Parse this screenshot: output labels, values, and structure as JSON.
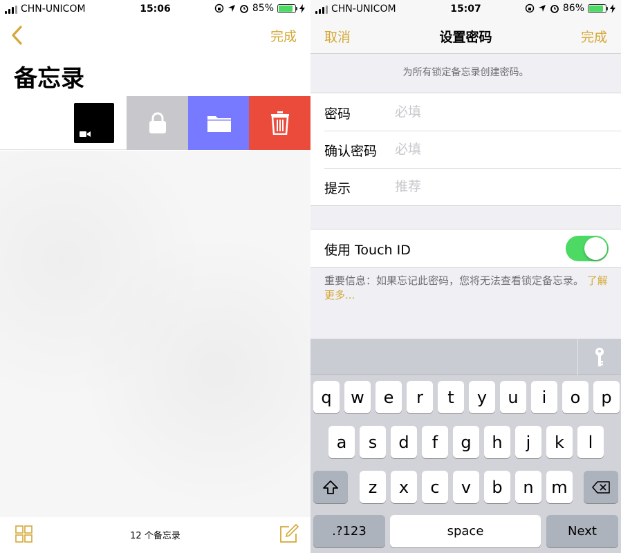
{
  "left": {
    "status": {
      "carrier": "CHN-UNICOM",
      "time": "15:06",
      "battery": "85%",
      "battery_level": 0.85
    },
    "nav": {
      "done": "完成"
    },
    "title": "备忘录",
    "bottom": {
      "count": "12 个备忘录"
    }
  },
  "right": {
    "status": {
      "carrier": "CHN-UNICOM",
      "time": "15:07",
      "battery": "86%",
      "battery_level": 0.86
    },
    "nav": {
      "cancel": "取消",
      "title": "设置密码",
      "done": "完成"
    },
    "hint": "为所有锁定备忘录创建密码。",
    "fields": [
      {
        "label": "密码",
        "placeholder": "必填"
      },
      {
        "label": "确认密码",
        "placeholder": "必填"
      },
      {
        "label": "提示",
        "placeholder": "推荐"
      }
    ],
    "touch_id": {
      "label": "使用 Touch ID",
      "enabled": true
    },
    "info": {
      "text": "重要信息：如果忘记此密码，您将无法查看锁定备忘录。",
      "link": "了解更多..."
    },
    "keyboard": {
      "row1": [
        "q",
        "w",
        "e",
        "r",
        "t",
        "y",
        "u",
        "i",
        "o",
        "p"
      ],
      "row2": [
        "a",
        "s",
        "d",
        "f",
        "g",
        "h",
        "j",
        "k",
        "l"
      ],
      "row3": [
        "z",
        "x",
        "c",
        "v",
        "b",
        "n",
        "m"
      ],
      "numbers": ".?123",
      "space": "space",
      "next": "Next"
    }
  },
  "colors": {
    "accent": "#d5a735",
    "delete": "#ea4b3b",
    "move": "#7779ff",
    "lock": "#c7c7cc",
    "toggle_on": "#4cd964"
  }
}
